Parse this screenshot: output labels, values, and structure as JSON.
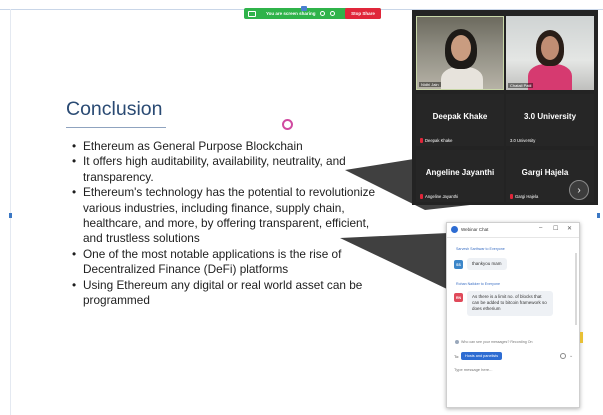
{
  "share_bar": {
    "status_text": "You are screen sharing",
    "stop_label": "Stop Share",
    "color": "#2fb34a",
    "stop_color": "#e0263a"
  },
  "slide": {
    "title": "Conclusion",
    "title_color": "#2a4a73",
    "bullets": [
      "Ethereum as General Purpose Blockchain",
      "It offers high auditability, availability, neutrality, and transparency.",
      "Ethereum's technology has the potential to revolutionize various industries, including finance, supply chain, healthcare, and more, by offering transparent, efficient, and trustless solutions",
      "One of the most notable applications is the rise of Decentralized Finance (DeFi) platforms",
      "Using Ethereum any digital or real world asset can be programmed"
    ]
  },
  "participants": {
    "video_tiles": [
      {
        "name": "Nidhi Jain"
      },
      {
        "name": "Chatali Patil"
      }
    ],
    "name_tiles": [
      {
        "display_name": "Deepak Khake",
        "label": "Deepak Khake",
        "muted": true
      },
      {
        "display_name": "3.0 University",
        "label": "3.0 University",
        "muted": false
      },
      {
        "display_name": "Angeline Jayanthi",
        "label": "Angeline Jayanthi",
        "muted": true
      },
      {
        "display_name": "Gargi Hajela",
        "label": "Gargi Hajela",
        "muted": true
      }
    ],
    "next_icon": "chevron-right-icon"
  },
  "chat": {
    "title": "Webinar Chat",
    "window_buttons": [
      "–",
      "☐",
      "✕"
    ],
    "messages": [
      {
        "from": "Sarvesh Sarthwar to Everyone",
        "avatar": "SS",
        "avatar_color": "#3b86c9",
        "text": "thankyou mam"
      },
      {
        "from": "Rohan Naikker to Everyone",
        "avatar": "RN",
        "avatar_color": "#e04a5a",
        "text": "As there is a limit no. of blocks that can be added to bitcoin framework so does etherium"
      }
    ],
    "who_can_see": "Who can see your messages? Recording On",
    "to_label": "To:",
    "to_value": "Hosts and panelists",
    "input_placeholder": "Type message here..."
  }
}
